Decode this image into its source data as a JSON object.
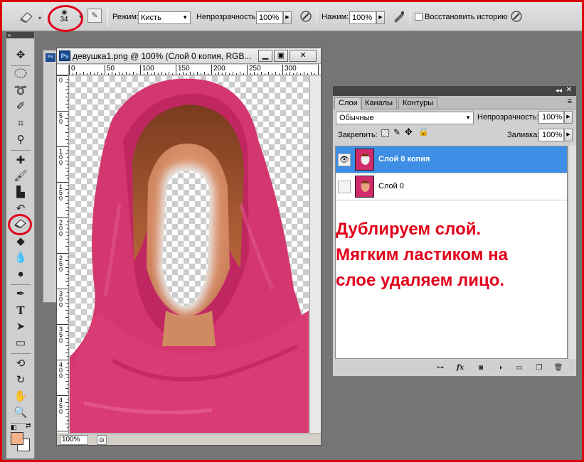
{
  "options_bar": {
    "brush_size": "34",
    "mode_label": "Режим:",
    "mode_value": "Кисть",
    "opacity_label": "Непрозрачность:",
    "opacity_value": "100%",
    "flow_label": "Нажим:",
    "flow_value": "100%",
    "restore_history_label": "Восстановить историю",
    "restore_history_checked": false
  },
  "document": {
    "title": "девушка1.png @ 100% (Слой 0 копия, RGB...",
    "zoom": "100%",
    "ruler_top": [
      "0",
      "50",
      "100",
      "150",
      "200",
      "250",
      "300"
    ],
    "ruler_left": [
      "0",
      "50",
      "100",
      "150",
      "200",
      "250",
      "300",
      "350",
      "400",
      "450"
    ]
  },
  "layers_panel": {
    "tabs": [
      "Слои",
      "Каналы",
      "Контуры"
    ],
    "active_tab": "Слои",
    "blend_mode": "Обычные",
    "opacity_label": "Непрозрачность:",
    "opacity_value": "100%",
    "lock_label": "Закрепить:",
    "fill_label": "Заливка:",
    "fill_value": "100%",
    "layers": [
      {
        "name": "Слой 0 копия",
        "visible": true,
        "selected": true
      },
      {
        "name": "Слой 0",
        "visible": false,
        "selected": false
      }
    ],
    "bottom_icons": [
      "link-icon",
      "fx-icon",
      "mask-icon",
      "adjustment-icon",
      "group-icon",
      "new-layer-icon",
      "trash-icon"
    ]
  },
  "annotation": {
    "lines": [
      "Дублируем слой.",
      "Мягким ластиком на",
      "слое удаляем лицо."
    ],
    "color": "#e2001a"
  },
  "colors": {
    "foreground": "#f7b188",
    "background": "#ffffff",
    "selection": "#3d8ee4",
    "highlight_ring": "#e0001a"
  },
  "tools": [
    "move-tool",
    "marquee-tool",
    "lasso-tool",
    "quick-select-tool",
    "crop-tool",
    "eyedropper-tool",
    "healing-tool",
    "brush-tool",
    "stamp-tool",
    "history-brush-tool",
    "eraser-tool",
    "bucket-tool",
    "blur-tool",
    "dodge-tool",
    "pen-tool",
    "type-tool",
    "path-select-tool",
    "rectangle-tool",
    "3d-rotate-tool",
    "3d-orbit-tool",
    "hand-tool",
    "zoom-tool"
  ]
}
